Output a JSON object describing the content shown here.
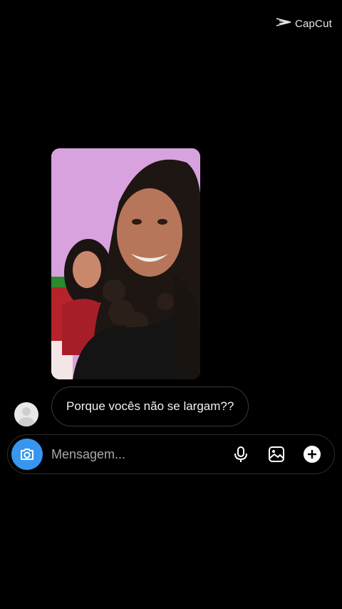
{
  "watermark": {
    "text": "CapCut"
  },
  "message": {
    "text": "Porque vocês não se largam??"
  },
  "composer": {
    "placeholder": "Mensagem..."
  },
  "icons": {
    "camera": "camera-icon",
    "mic": "microphone-icon",
    "gallery": "image-icon",
    "more": "plus-circle-icon"
  },
  "colors": {
    "accent": "#3797f0",
    "background": "#000000"
  }
}
